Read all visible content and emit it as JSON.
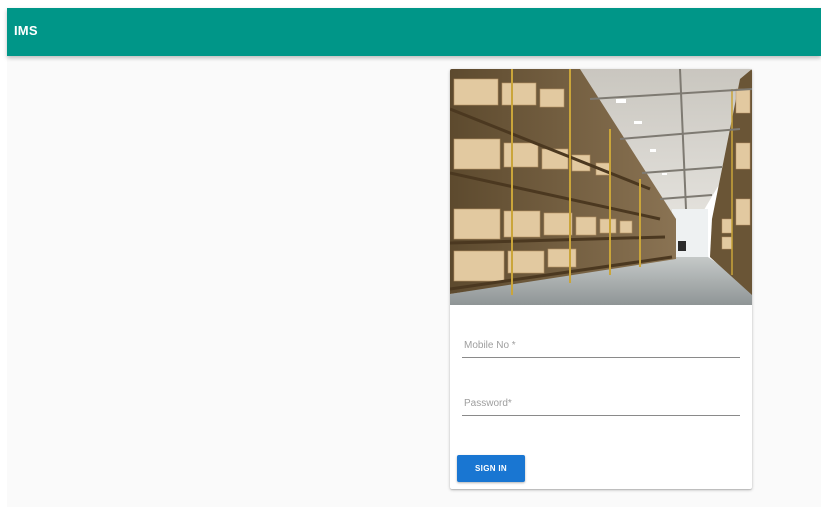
{
  "appbar": {
    "title": "IMS",
    "color": "#009688"
  },
  "login": {
    "image": "warehouse-shelves-photo",
    "mobile_label": "Mobile No *",
    "password_label": "Password*",
    "signin_label": "SIGN IN",
    "button_color": "#1976d2"
  }
}
